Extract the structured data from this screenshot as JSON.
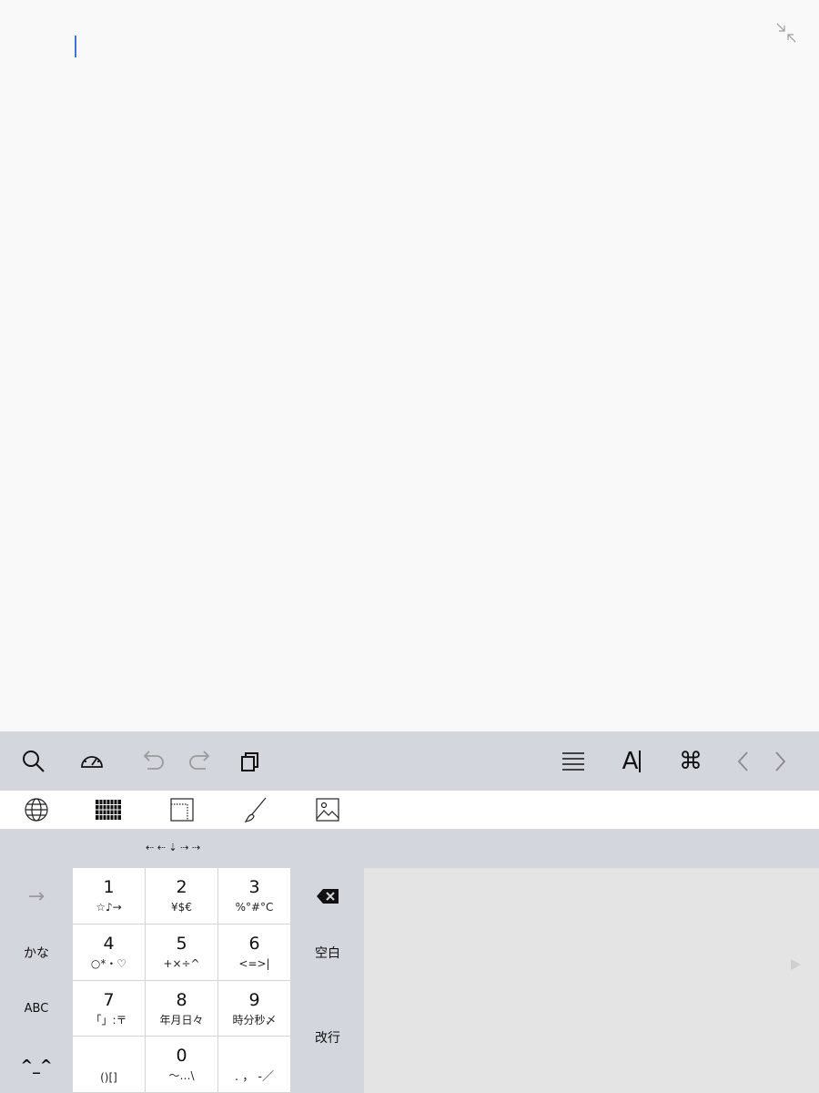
{
  "keyboard": {
    "arrow_hint": "⇠ ⇠ ⇣ ⇢ ⇢",
    "keys": [
      {
        "main": "1",
        "sub": "☆♪→"
      },
      {
        "main": "2",
        "sub": "¥$€"
      },
      {
        "main": "3",
        "sub": "%°#°C"
      },
      {
        "main": "4",
        "sub": "○*・♡"
      },
      {
        "main": "5",
        "sub": "+×÷^"
      },
      {
        "main": "6",
        "sub": "<=>|"
      },
      {
        "main": "7",
        "sub": "「」:〒"
      },
      {
        "main": "8",
        "sub": "年月日々"
      },
      {
        "main": "9",
        "sub": "時分秒〆"
      },
      {
        "main": "",
        "sub": "()[]"
      },
      {
        "main": "0",
        "sub": "〜…\\"
      },
      {
        "main": "",
        "sub": ". ， -／"
      }
    ],
    "side": {
      "next_arrow": "→",
      "kana": "かな",
      "abc": "ABC",
      "emoticon": "^_^",
      "space": "空白",
      "return": "改行"
    }
  },
  "icons": {
    "toolbar_left": [
      "search-icon",
      "speedometer-icon",
      "undo-icon",
      "redo-icon",
      "copy-icon"
    ],
    "toolbar_right": [
      "align-justify-icon",
      "text-cursor-icon",
      "command-icon",
      "chevron-left-icon",
      "chevron-right-icon"
    ],
    "tool_row": [
      "globe-icon",
      "keyboard-grid-icon",
      "selection-box-icon",
      "brush-icon",
      "image-icon"
    ]
  },
  "toolbar": {
    "text_format_label": "A",
    "command_label": "⌘"
  },
  "colors": {
    "caret": "#3b73d9",
    "toolbar_bg": "#d3d6dc",
    "editor_bg": "#f9f9f9",
    "right_panel_bg": "#e4e4e4"
  }
}
